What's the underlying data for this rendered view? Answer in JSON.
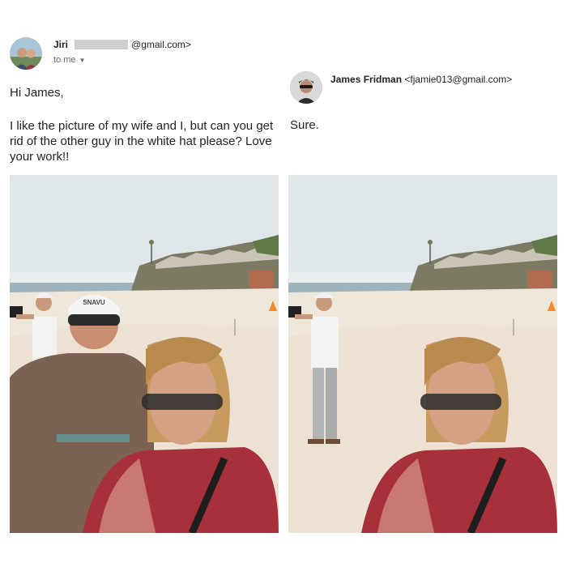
{
  "original_email": {
    "sender_name": "Jiri",
    "sender_email_suffix": "@gmail.com>",
    "recipient_line": "to me",
    "greeting": "Hi James,",
    "body": "I like the picture of my wife and I,  but can you get rid of the other guy in the white hat please? Love your work!!"
  },
  "reply_email": {
    "sender_name": "James Fridman",
    "sender_email": "<fjamie013@gmail.com>",
    "body": "Sure."
  },
  "photos": {
    "hat_text": "SNAVU",
    "original_has_man_in_cap": true,
    "edited_has_man_in_cap": false
  },
  "colors": {
    "sky": "#dfe6ea",
    "sand": "#efe6da",
    "sea": "#9fb3bd",
    "shirt_woman": "#a8303a",
    "shirt_man": "#7b6252"
  }
}
